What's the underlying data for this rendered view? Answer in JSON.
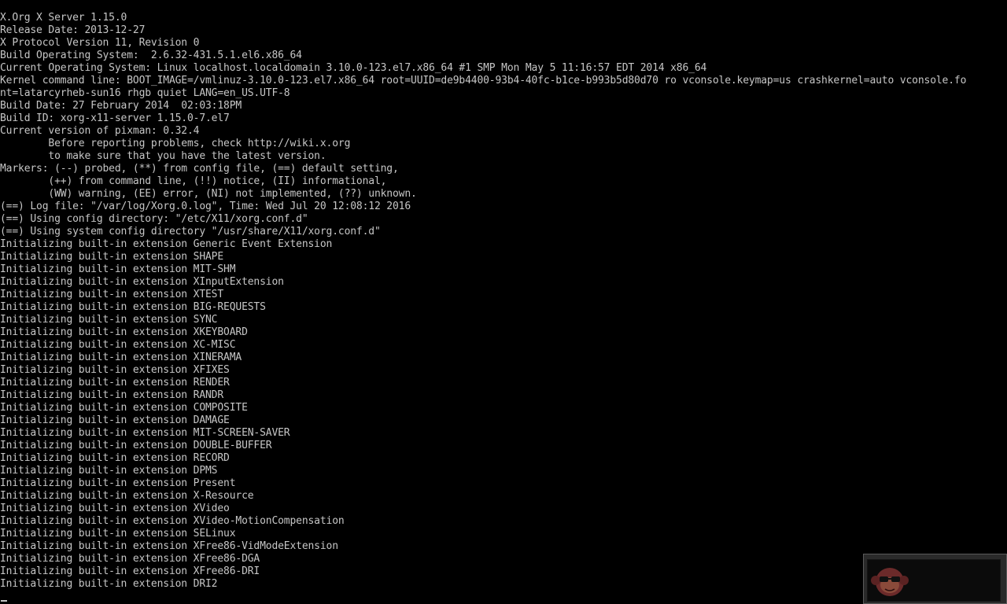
{
  "console": {
    "lines": [
      "X.Org X Server 1.15.0",
      "Release Date: 2013-12-27",
      "X Protocol Version 11, Revision 0",
      "Build Operating System:  2.6.32-431.5.1.el6.x86_64",
      "Current Operating System: Linux localhost.localdomain 3.10.0-123.el7.x86_64 #1 SMP Mon May 5 11:16:57 EDT 2014 x86_64",
      "Kernel command line: BOOT_IMAGE=/vmlinuz-3.10.0-123.el7.x86_64 root=UUID=de9b4400-93b4-40fc-b1ce-b993b5d80d70 ro vconsole.keymap=us crashkernel=auto vconsole.fo",
      "nt=latarcyrheb-sun16 rhgb quiet LANG=en_US.UTF-8",
      "Build Date: 27 February 2014  02:03:18PM",
      "Build ID: xorg-x11-server 1.15.0-7.el7",
      "Current version of pixman: 0.32.4",
      "        Before reporting problems, check http://wiki.x.org",
      "        to make sure that you have the latest version.",
      "Markers: (--) probed, (**) from config file, (==) default setting,",
      "        (++) from command line, (!!) notice, (II) informational,",
      "        (WW) warning, (EE) error, (NI) not implemented, (??) unknown.",
      "(==) Log file: \"/var/log/Xorg.0.log\", Time: Wed Jul 20 12:08:12 2016",
      "(==) Using config directory: \"/etc/X11/xorg.conf.d\"",
      "(==) Using system config directory \"/usr/share/X11/xorg.conf.d\"",
      "Initializing built-in extension Generic Event Extension",
      "Initializing built-in extension SHAPE",
      "Initializing built-in extension MIT-SHM",
      "Initializing built-in extension XInputExtension",
      "Initializing built-in extension XTEST",
      "Initializing built-in extension BIG-REQUESTS",
      "Initializing built-in extension SYNC",
      "Initializing built-in extension XKEYBOARD",
      "Initializing built-in extension XC-MISC",
      "Initializing built-in extension XINERAMA",
      "Initializing built-in extension XFIXES",
      "Initializing built-in extension RENDER",
      "Initializing built-in extension RANDR",
      "Initializing built-in extension COMPOSITE",
      "Initializing built-in extension DAMAGE",
      "Initializing built-in extension MIT-SCREEN-SAVER",
      "Initializing built-in extension DOUBLE-BUFFER",
      "Initializing built-in extension RECORD",
      "Initializing built-in extension DPMS",
      "Initializing built-in extension Present",
      "Initializing built-in extension X-Resource",
      "Initializing built-in extension XVideo",
      "Initializing built-in extension XVideo-MotionCompensation",
      "Initializing built-in extension SELinux",
      "Initializing built-in extension XFree86-VidModeExtension",
      "Initializing built-in extension XFree86-DGA",
      "Initializing built-in extension XFree86-DRI",
      "Initializing built-in extension DRI2"
    ]
  },
  "cursor": {
    "icon": "text-cursor-icon"
  },
  "overlay": {
    "avatar_icon": "monkey-sunglasses-icon"
  },
  "colors": {
    "background": "#000000",
    "text": "#c6c6c6",
    "overlay_background": "#2a2a2a",
    "avatar": "#6b2a2a"
  }
}
